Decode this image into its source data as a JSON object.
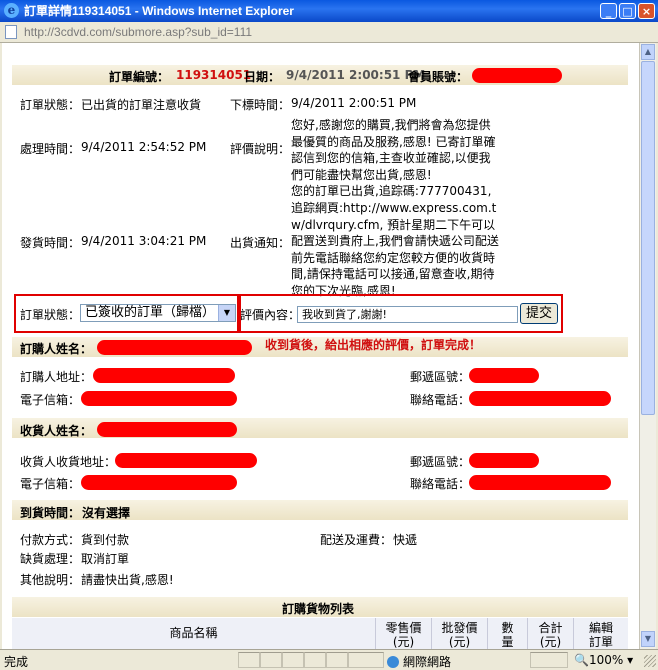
{
  "window": {
    "title": "訂單詳情119314051 - Windows Internet Explorer",
    "url": "http://3cdvd.com/submore.asp?sub_id=111"
  },
  "order": {
    "number_label": "訂單編號：",
    "number": "119314051",
    "date_label": "日期：",
    "date": "9/4/2011 2:00:51 PM",
    "member_label": "會員賬號："
  },
  "details": {
    "status_label": "訂單狀態：",
    "status": "已出貨的訂單注意收貨",
    "order_time_label": "下標時間：",
    "order_time": "9/4/2011 2:00:51 PM",
    "process_time_label": "處理時間：",
    "process_time": "9/4/2011 2:54:52 PM",
    "review_label": "評價說明：",
    "review_text": "您好,感謝您的購買,我們將會為您提供最優質的商品及服務,感恩! 已寄訂單確認信到您的信箱,主查收並確認,以便我們可能盡快幫您出貨,感恩!",
    "ship_time_label": "發貨時間：",
    "ship_time": "9/4/2011 3:04:21 PM",
    "ship_notice_label": "出貨通知：",
    "ship_notice_text": "您的訂單已出貨,追踪碼:777700431, 追踪網頁:http://www.express.com.tw/dlvrqury.cfm, 預計星期二下午可以配置送到貴府上,我們會請快遞公司配送前先電話聯絡您約定您較方便的收貨時間,請保持電話可以接通,留意查收,期待您的下次光臨,感恩!"
  },
  "form": {
    "status_label": "訂單狀態：",
    "status_value": "已簽收的訂單（歸檔）",
    "eval_label": "評價內容：",
    "eval_value": "我收到貨了,謝謝!",
    "submit_label": "提交",
    "hint": "收到貨後，給出相應的評價，訂單完成！"
  },
  "buyer": {
    "name_label": "訂購人姓名：",
    "address_label": "訂購人地址：",
    "postcode_label": "郵遞區號：",
    "email_label": "電子信箱：",
    "phone_label": "聯絡電話："
  },
  "receiver": {
    "name_label": "收貨人姓名：",
    "address_label": "收貨人收貨地址：",
    "postcode_label": "郵遞區號：",
    "email_label": "電子信箱：",
    "phone_label": "聯絡電話："
  },
  "delivery": {
    "time_label": "到貨時間：",
    "time_value": "沒有選擇",
    "payment_label": "付款方式：",
    "payment_value": "貨到付款",
    "shipping_label": "配送及運費：",
    "shipping_value": "快遞",
    "shortage_label": "缺貨處理：",
    "shortage_value": "取消訂單",
    "other_label": "其他說明：",
    "other_value": "請盡快出貨,感恩!"
  },
  "goods": {
    "title": "訂購貨物列表",
    "columns": [
      "商品名稱",
      "零售價(元)",
      "批發價(元)",
      "數量",
      "合計(元)",
      "編輯訂單"
    ]
  },
  "status_bar": {
    "text": "完成",
    "zone": "網際網路",
    "zoom": "100%"
  },
  "colors": {
    "title_bar": "#0a58e0",
    "accent_red": "#d01010",
    "section_bg": "#f3ecd3",
    "redaction": "#ff0000"
  }
}
